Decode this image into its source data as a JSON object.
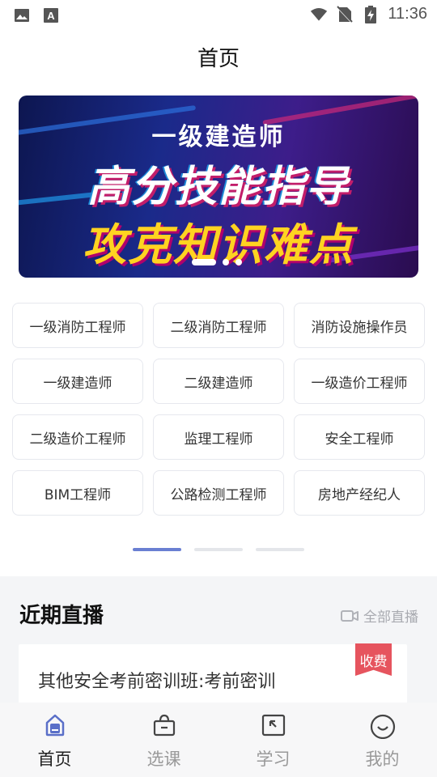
{
  "status_bar": {
    "time": "11:36"
  },
  "header": {
    "title": "首页"
  },
  "banner": {
    "subtitle": "一级建造师",
    "line1": "高分技能指导",
    "line2": "攻克知识难点"
  },
  "categories": [
    "一级消防工程师",
    "二级消防工程师",
    "消防设施操作员",
    "一级建造师",
    "二级建造师",
    "一级造价工程师",
    "二级造价工程师",
    "监理工程师",
    "安全工程师",
    "BIM工程师",
    "公路检测工程师",
    "房地产经纪人"
  ],
  "live": {
    "title": "近期直播",
    "all_label": "全部直播",
    "card": {
      "title": "其他安全考前密训班:考前密训",
      "badge": "收费"
    }
  },
  "tabbar": {
    "items": [
      {
        "label": "首页",
        "icon": "home-icon",
        "active": true
      },
      {
        "label": "选课",
        "icon": "basket-icon",
        "active": false
      },
      {
        "label": "学习",
        "icon": "study-icon",
        "active": false
      },
      {
        "label": "我的",
        "icon": "smile-icon",
        "active": false
      }
    ]
  },
  "colors": {
    "accent": "#6a7fd2",
    "badge": "#e6545e",
    "banner_yellow": "#ffd321"
  }
}
